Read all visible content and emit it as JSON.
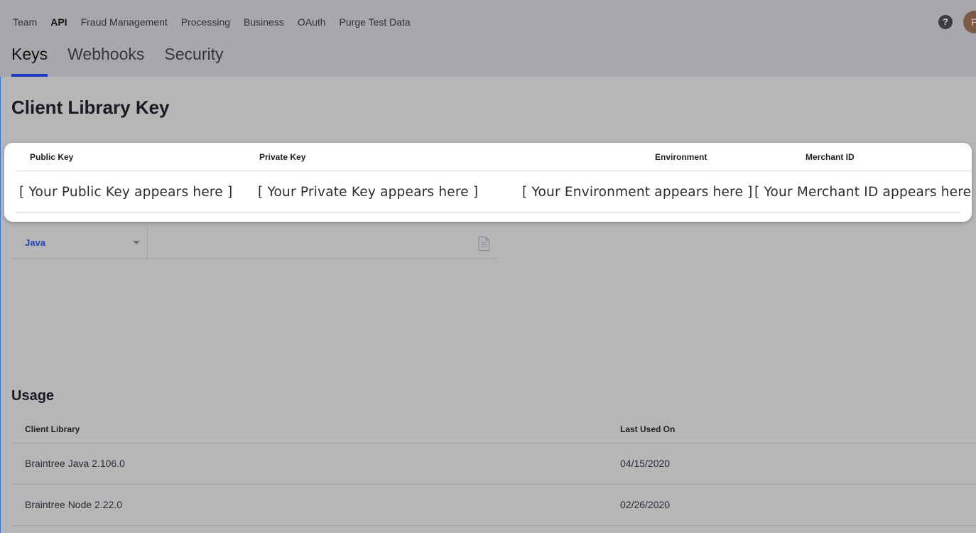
{
  "top_nav": {
    "items": [
      "Team",
      "API",
      "Fraud Management",
      "Processing",
      "Business",
      "OAuth",
      "Purge Test Data"
    ],
    "active": "API"
  },
  "header": {
    "help_label": "?",
    "avatar_initial": "P"
  },
  "sub_tabs": [
    {
      "label": "Keys",
      "active": true
    },
    {
      "label": "Webhooks",
      "active": false
    },
    {
      "label": "Security",
      "active": false
    }
  ],
  "client_library_key": {
    "title": "Client Library Key",
    "columns": [
      "Public Key",
      "Private Key",
      "Environment",
      "Merchant ID"
    ],
    "values": [
      "[ Your Public Key appears here ]",
      "[ Your Private Key appears here ]",
      "[ Your Environment appears here ]",
      "[ Your Merchant ID appears here ]"
    ]
  },
  "language_selector": {
    "selected": "Java",
    "copy_icon": "copy-document-icon"
  },
  "usage": {
    "title": "Usage",
    "columns": [
      "Client Library",
      "Last Used On"
    ],
    "rows": [
      {
        "library": "Braintree Java 2.106.0",
        "last_used": "04/15/2020"
      },
      {
        "library": "Braintree Node 2.22.0",
        "last_used": "02/26/2020"
      }
    ]
  },
  "colors": {
    "accent": "#1f3ac0",
    "overlay_background": "#b5b6b8",
    "card": "#ffffff"
  }
}
